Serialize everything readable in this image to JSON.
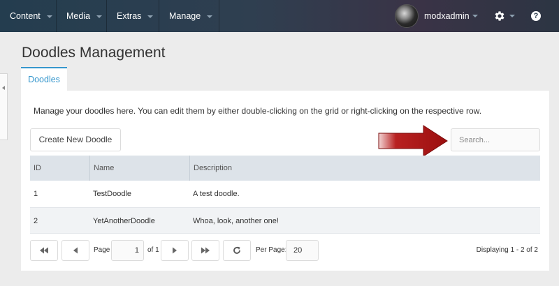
{
  "topbar": {
    "menu": [
      {
        "label": "Content"
      },
      {
        "label": "Media"
      },
      {
        "label": "Extras"
      },
      {
        "label": "Manage"
      }
    ],
    "username": "modxadmin",
    "help_icon_text": "?"
  },
  "page": {
    "title": "Doodles Management",
    "tab": "Doodles",
    "description": "Manage your doodles here. You can edit them by either double-clicking on the grid or right-clicking on the respective row."
  },
  "toolbar": {
    "create_label": "Create New Doodle",
    "search_placeholder": "Search..."
  },
  "grid": {
    "columns": [
      "ID",
      "Name",
      "Description"
    ],
    "rows": [
      {
        "id": "1",
        "name": "TestDoodle",
        "description": "A test doodle."
      },
      {
        "id": "2",
        "name": "YetAnotherDoodle",
        "description": "Whoa, look, another one!"
      }
    ]
  },
  "pager": {
    "page_label": "Page",
    "current_page": "1",
    "of_label": "of 1",
    "per_page_label": "Per Page:",
    "per_page_value": "20",
    "display_info": "Displaying 1 - 2 of 2"
  },
  "colors": {
    "accent": "#3697cd",
    "arrow": "#b01515",
    "header_bg": "#dde3e9"
  },
  "icons": [
    "user-avatar",
    "gear-icon",
    "help-icon",
    "first-page-icon",
    "prev-page-icon",
    "next-page-icon",
    "last-page-icon",
    "refresh-icon",
    "red-arrow-annotation"
  ]
}
